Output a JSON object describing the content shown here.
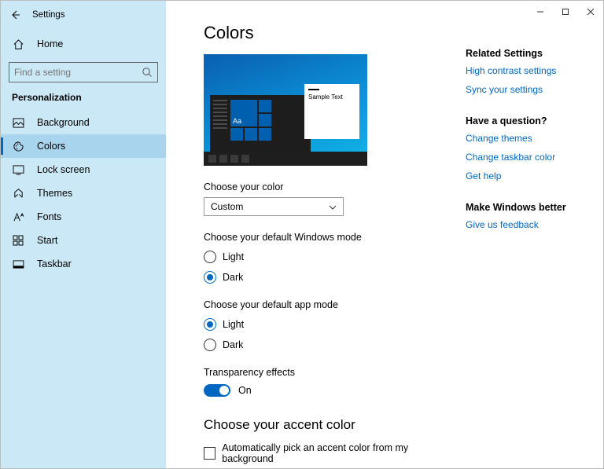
{
  "app_title": "Settings",
  "home_label": "Home",
  "search": {
    "placeholder": "Find a setting"
  },
  "section_title": "Personalization",
  "nav": {
    "items": [
      {
        "label": "Background"
      },
      {
        "label": "Colors"
      },
      {
        "label": "Lock screen"
      },
      {
        "label": "Themes"
      },
      {
        "label": "Fonts"
      },
      {
        "label": "Start"
      },
      {
        "label": "Taskbar"
      }
    ]
  },
  "page": {
    "title": "Colors",
    "preview": {
      "big_tile": "Aa",
      "sample": "Sample Text"
    },
    "choose_color_label": "Choose your color",
    "color_mode": "Custom",
    "windows_mode_label": "Choose your default Windows mode",
    "windows_mode": {
      "light": "Light",
      "dark": "Dark",
      "selected": "dark"
    },
    "app_mode_label": "Choose your default app mode",
    "app_mode": {
      "light": "Light",
      "dark": "Dark",
      "selected": "light"
    },
    "transparency_label": "Transparency effects",
    "transparency_state": "On",
    "accent_heading": "Choose your accent color",
    "auto_accent_label": "Automatically pick an accent color from my background"
  },
  "aside": {
    "related_title": "Related Settings",
    "related_links": [
      "High contrast settings",
      "Sync your settings"
    ],
    "question_title": "Have a question?",
    "question_links": [
      "Change themes",
      "Change taskbar color",
      "Get help"
    ],
    "better_title": "Make Windows better",
    "better_links": [
      "Give us feedback"
    ]
  }
}
